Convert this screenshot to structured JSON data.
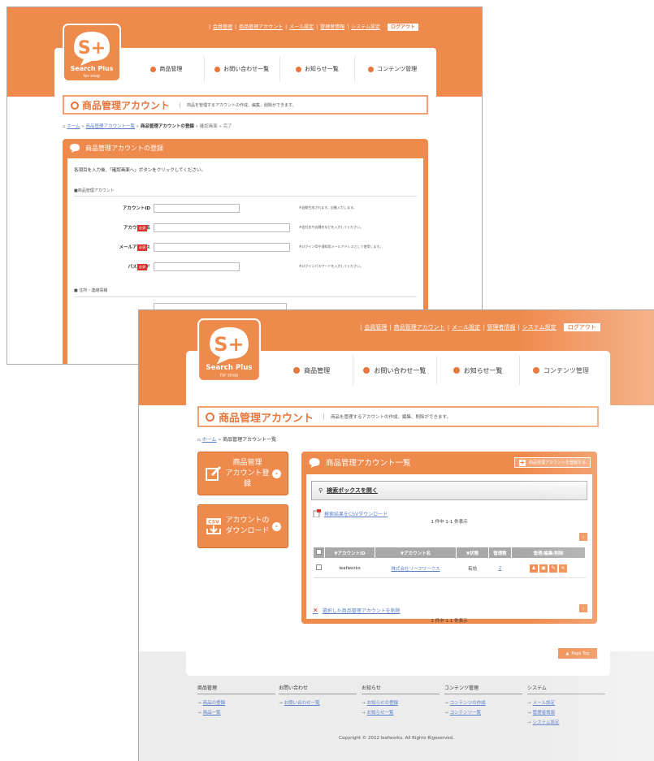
{
  "brand": {
    "name": "Search Plus",
    "sub": "for shop",
    "accent": "#ef8a4d"
  },
  "back": {
    "toplinks": [
      "会員管理",
      "商品管理アカウント",
      "メール設定",
      "管理者情報",
      "システム設定"
    ],
    "logout": "ログアウト",
    "nav": [
      "商品管理",
      "お問い合わせ一覧",
      "お知らせ一覧",
      "コンテンツ管理"
    ],
    "title": "商品管理アカウント",
    "title_desc": "商品を管理するアカウントの作成、編集、削除ができます。",
    "crumb": {
      "home": "ホーム",
      "list": "商品管理アカウント一覧",
      "current": "商品管理アカウントの登録",
      "confirm": "確認画面",
      "done": "完了"
    },
    "panel_title": "商品管理アカウントの登録",
    "intro": "各項目を入力後、「確認画面へ」ボタンをクリックしてください。",
    "section1": "■商品管理アカウント",
    "required": "必須",
    "fields": [
      {
        "label": "アカウントID",
        "required": false,
        "note": "※自動生成されます。自動入力します。"
      },
      {
        "label": "アカウント名",
        "required": true,
        "note": "※会社名や店舗名などを入力してください。"
      },
      {
        "label": "メールアドレス",
        "required": true,
        "note": "※ログインIDや通知用メールアドレスとして使用します。"
      },
      {
        "label": "パスワード",
        "required": true,
        "note": "※ログインパスワードを入力してください。"
      }
    ],
    "section2": "■ 住所・連絡情報"
  },
  "front": {
    "toplinks": [
      "会員管理",
      "商品管理アカウント",
      "メール設定",
      "管理者情報",
      "システム設定"
    ],
    "logout": "ログアウト",
    "nav": [
      "商品管理",
      "お問い合わせ一覧",
      "お知らせ一覧",
      "コンテンツ管理"
    ],
    "title": "商品管理アカウント",
    "title_desc": "商品を管理するアカウントの作成、編集、削除ができます。",
    "crumb": {
      "home": "ホーム",
      "current": "商品管理アカウント一覧"
    },
    "side_register": [
      "商品管理",
      "アカウント登録"
    ],
    "side_download": [
      "アカウントの",
      "ダウンロード"
    ],
    "csv_badge": "CSV",
    "panel_title": "商品管理アカウント一覧",
    "register_btn": "商品管理アカウントを登録する",
    "search_label": "検索ボックスを開く",
    "csv_link": "検索結果をCSVダウンロード",
    "count_text": "1 件中 1-1 件表示",
    "table": {
      "headers": [
        "",
        "▼アカウントID",
        "▼アカウント名",
        "▼状態",
        "管理数",
        "管理/編集/削除"
      ],
      "rows": [
        {
          "id": "leafworks",
          "name": "株式会社リーフワークス",
          "status": "有効",
          "count": "2"
        }
      ]
    },
    "delete_link": "選択した商品管理アカウントを削除",
    "page_top": "Page Top",
    "footer": [
      {
        "head": "商品管理",
        "items": [
          "商品の登録",
          "商品一覧"
        ]
      },
      {
        "head": "お問い合わせ",
        "items": [
          "お問い合わせ一覧"
        ]
      },
      {
        "head": "お知らせ",
        "items": [
          "お知らせの登録",
          "お知らせ一覧"
        ]
      },
      {
        "head": "コンテンツ管理",
        "items": [
          "コンテンツの作成",
          "コンテンツ一覧"
        ]
      },
      {
        "head": "システム",
        "items": [
          "メール設定",
          "管理者情報",
          "システム設定"
        ]
      }
    ],
    "copyright": "Copyright © 2012 leafworks. All Rights Rigeserved."
  }
}
